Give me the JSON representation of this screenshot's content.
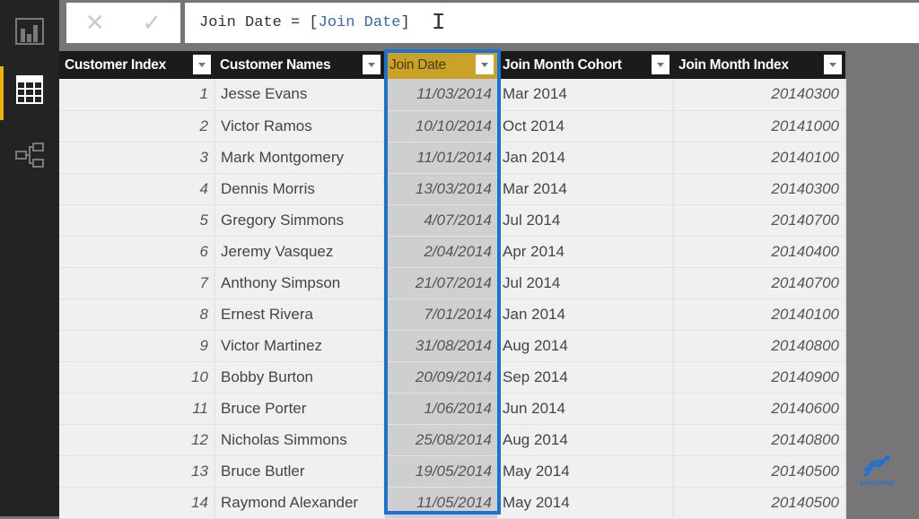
{
  "sidebar": {
    "items": [
      {
        "name": "report-view",
        "icon": "bar-chart-icon"
      },
      {
        "name": "data-view",
        "icon": "table-icon",
        "active": true
      },
      {
        "name": "relationships-view",
        "icon": "relationships-icon"
      }
    ]
  },
  "formula_bar": {
    "cancel_icon": "✕",
    "commit_icon": "✓",
    "formula_prefix": "Join Date = [",
    "formula_ref": "Join Date",
    "formula_suffix": "]",
    "cursor": "I"
  },
  "table": {
    "columns": [
      "Customer Index",
      "Customer Names",
      "Join Date",
      "Join Month Cohort",
      "Join Month Index"
    ],
    "selected_column": "Join Date",
    "rows": [
      {
        "index": "1",
        "name": "Jesse Evans",
        "join_date": "11/03/2014",
        "cohort": "Mar 2014",
        "month_index": "20140300"
      },
      {
        "index": "2",
        "name": "Victor Ramos",
        "join_date": "10/10/2014",
        "cohort": "Oct 2014",
        "month_index": "20141000"
      },
      {
        "index": "3",
        "name": "Mark Montgomery",
        "join_date": "11/01/2014",
        "cohort": "Jan 2014",
        "month_index": "20140100"
      },
      {
        "index": "4",
        "name": "Dennis Morris",
        "join_date": "13/03/2014",
        "cohort": "Mar 2014",
        "month_index": "20140300"
      },
      {
        "index": "5",
        "name": "Gregory Simmons",
        "join_date": "4/07/2014",
        "cohort": "Jul 2014",
        "month_index": "20140700"
      },
      {
        "index": "6",
        "name": "Jeremy Vasquez",
        "join_date": "2/04/2014",
        "cohort": "Apr 2014",
        "month_index": "20140400"
      },
      {
        "index": "7",
        "name": "Anthony Simpson",
        "join_date": "21/07/2014",
        "cohort": "Jul 2014",
        "month_index": "20140700"
      },
      {
        "index": "8",
        "name": "Ernest Rivera",
        "join_date": "7/01/2014",
        "cohort": "Jan 2014",
        "month_index": "20140100"
      },
      {
        "index": "9",
        "name": "Victor Martinez",
        "join_date": "31/08/2014",
        "cohort": "Aug 2014",
        "month_index": "20140800"
      },
      {
        "index": "10",
        "name": "Bobby Burton",
        "join_date": "20/09/2014",
        "cohort": "Sep 2014",
        "month_index": "20140900"
      },
      {
        "index": "11",
        "name": "Bruce Porter",
        "join_date": "1/06/2014",
        "cohort": "Jun 2014",
        "month_index": "20140600"
      },
      {
        "index": "12",
        "name": "Nicholas Simmons",
        "join_date": "25/08/2014",
        "cohort": "Aug 2014",
        "month_index": "20140800"
      },
      {
        "index": "13",
        "name": "Bruce Butler",
        "join_date": "19/05/2014",
        "cohort": "May 2014",
        "month_index": "20140500"
      },
      {
        "index": "14",
        "name": "Raymond Alexander",
        "join_date": "11/05/2014",
        "cohort": "May 2014",
        "month_index": "20140500"
      }
    ]
  },
  "watermark": {
    "label": "SUBSCRIBE",
    "icon": "dna-icon"
  },
  "colors": {
    "selection_border": "#1a73d0",
    "selected_header": "#c9a227",
    "active_nav": "#e8b10e"
  }
}
